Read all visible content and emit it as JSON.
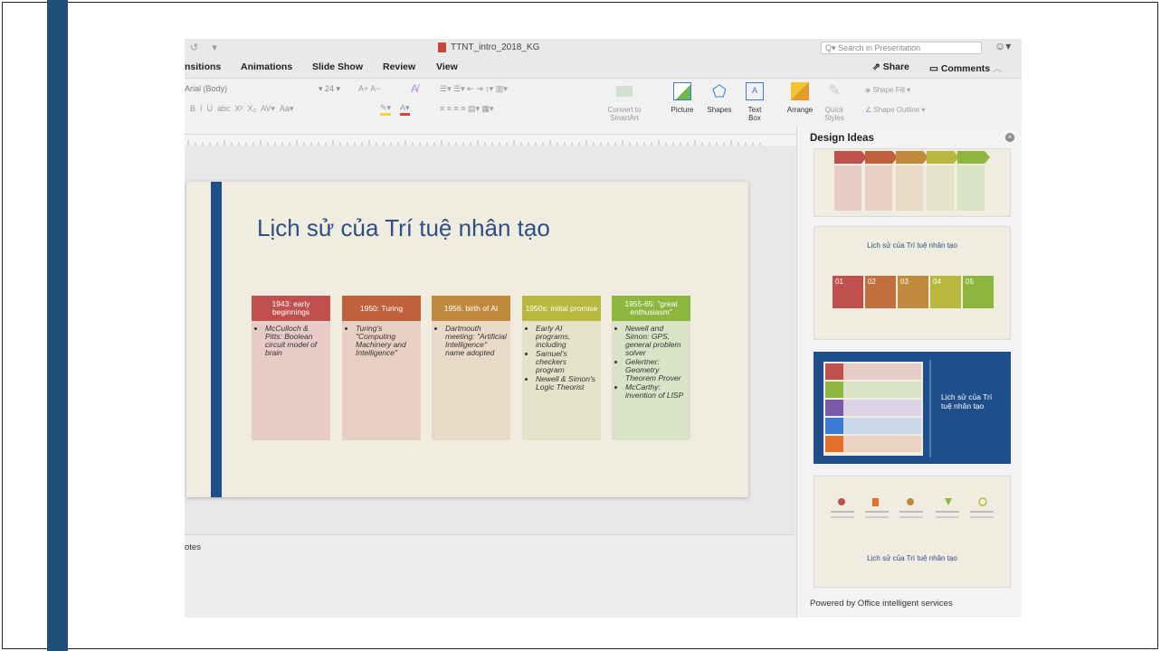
{
  "window": {
    "doc_title": "TTNT_intro_2018_KG",
    "search_placeholder": "Search in Presentation"
  },
  "menu": {
    "items": [
      "nsitions",
      "Animations",
      "Slide Show",
      "Review",
      "View"
    ],
    "share": "Share",
    "comments": "Comments"
  },
  "ribbon": {
    "font_name": "Arial (Body)",
    "font_size": "24",
    "convert_smartart": [
      "Convert to",
      "SmartArt"
    ],
    "picture": "Picture",
    "shapes": "Shapes",
    "text_box": [
      "Text",
      "Box"
    ],
    "arrange": "Arrange",
    "quick_styles": [
      "Quick",
      "Styles"
    ],
    "shape_fill": "Shape Fill",
    "shape_outline": "Shape Outline"
  },
  "slide": {
    "title": "Lịch sử của Trí tuệ nhân tạo",
    "columns": [
      {
        "header": "1943: early beginnings",
        "color": "#c0504d",
        "body_color": "#e6cbc6",
        "bullets": [
          "McCulloch & Pitts: Boolean circuit model of brain"
        ]
      },
      {
        "header": "1950: Turing",
        "color": "#c0603d",
        "body_color": "#e7d0c3",
        "bullets": [
          "Turing's \"Computing Machinery and Intelligence\""
        ]
      },
      {
        "header": "1956: birth of AI",
        "color": "#c08a3d",
        "body_color": "#e8dac7",
        "bullets": [
          "Dartmouth meeting: \"Artificial Intelligence\" name adopted"
        ]
      },
      {
        "header": "1950s: initial promise",
        "color": "#b9b83e",
        "body_color": "#e4e2c7",
        "bullets": [
          "Early AI programs, including",
          "Samuel's checkers program",
          "Newell & Simon's Logic Theorist"
        ]
      },
      {
        "header": "1955-65: \"great enthusiasm\"",
        "color": "#8cb63e",
        "body_color": "#dbe3c6",
        "bullets": [
          "Newell and Simon: GPS, general problem solver",
          "Gelertner: Geometry Theorem Prover",
          "McCarthy: invention of LISP"
        ]
      }
    ]
  },
  "notes": {
    "label": "otes"
  },
  "design_ideas": {
    "title": "Design Ideas",
    "thumb_caption_2": "Lịch sử của Trí tuệ nhân tạo",
    "numbers": [
      "01",
      "02",
      "03",
      "04",
      "05"
    ],
    "thumb3_title": "Lịch sử của Trí tuệ nhân tạo",
    "thumb_caption_4": "Lịch sử của Trí tuệ nhân tạo",
    "powered_by": "Powered by Office intelligent services"
  }
}
